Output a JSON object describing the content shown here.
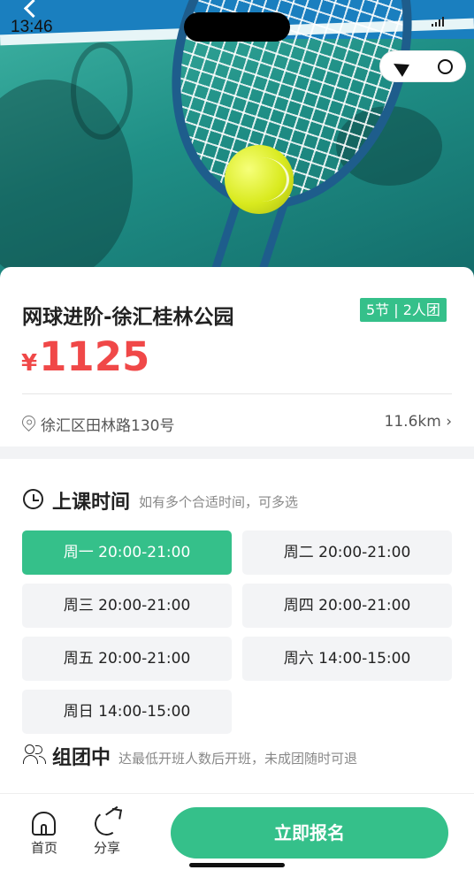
{
  "status_bar": {
    "time": "13:46"
  },
  "course": {
    "title": "网球进阶-徐汇桂林公园",
    "tag": "5节 | 2人团",
    "currency": "¥",
    "price": "1125",
    "address": "徐汇区田林路130号",
    "distance": "11.6km ›"
  },
  "schedule": {
    "title": "上课时间",
    "subtitle": "如有多个合适时间，可多选",
    "slots": [
      {
        "label": "周一 20:00-21:00",
        "selected": true
      },
      {
        "label": "周二 20:00-21:00",
        "selected": false
      },
      {
        "label": "周三 20:00-21:00",
        "selected": false
      },
      {
        "label": "周四 20:00-21:00",
        "selected": false
      },
      {
        "label": "周五 20:00-21:00",
        "selected": false
      },
      {
        "label": "周六 14:00-15:00",
        "selected": false
      },
      {
        "label": "周日 14:00-15:00",
        "selected": false
      }
    ]
  },
  "group": {
    "title": "组团中",
    "subtitle": "达最低开班人数后开班，未成团随时可退"
  },
  "bottom_bar": {
    "home_label": "首页",
    "share_label": "分享",
    "cta_label": "立即报名"
  },
  "colors": {
    "accent": "#35c08a",
    "price": "#f04848"
  }
}
